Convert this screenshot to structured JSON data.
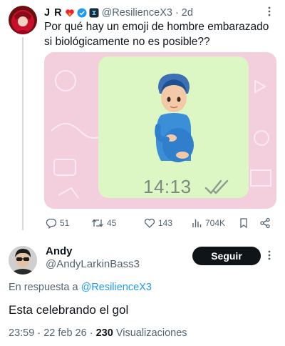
{
  "tweet": {
    "author_name": "J R",
    "handle": "@ResilienceX3",
    "separator": "·",
    "time_ago": "2d",
    "text": "Por qué hay un emoji de hombre embarazado si biológicamente no es posible??",
    "media": {
      "time": "14:13",
      "bubble_color": "#dcf6c4",
      "background_color": "#f3cfdd"
    },
    "stats": {
      "replies": "51",
      "retweets": "45",
      "likes": "143",
      "views": "704K"
    },
    "icons": [
      "heart-flame-icon",
      "verified-badge-icon",
      "affiliate-badge-icon",
      "more-icon",
      "reply-icon",
      "retweet-icon",
      "like-icon",
      "views-icon",
      "bookmark-icon",
      "share-icon"
    ]
  },
  "reply": {
    "author_name": "Andy",
    "handle": "@AndyLarkinBass3",
    "follow_label": "Seguir",
    "replying_to_prefix": "En respuesta a",
    "replying_to_handle": "@ResilienceX3",
    "text": "Esta celebrando el gol",
    "time": "23:59",
    "separator": "·",
    "date": "22 feb 26",
    "separator2": "·",
    "views_count": "230",
    "views_label": "Visualizaciones"
  },
  "colors": {
    "accent": "#1d9bf0",
    "text": "#0f1419",
    "muted": "#536471",
    "follow_button": "#0f1419"
  }
}
